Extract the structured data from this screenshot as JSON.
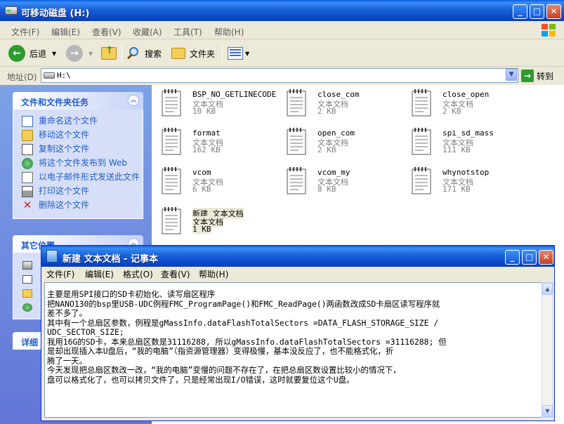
{
  "explorer": {
    "title": "可移动磁盘 (H:)",
    "menu": [
      "文件(F)",
      "编辑(E)",
      "查看(V)",
      "收藏(A)",
      "工具(T)",
      "帮助(H)"
    ],
    "toolbar": {
      "back_label": "后退",
      "search_label": "搜索",
      "folders_label": "文件夹"
    },
    "address": {
      "label": "地址(D)",
      "value": "H:\\",
      "go_label": "转到"
    },
    "task_pane": {
      "file_tasks": {
        "title": "文件和文件夹任务",
        "items": [
          {
            "label": "重命名这个文件",
            "icon": "rename-icon"
          },
          {
            "label": "移动这个文件",
            "icon": "move-icon"
          },
          {
            "label": "复制这个文件",
            "icon": "copy-icon"
          },
          {
            "label": "将这个文件发布到 Web",
            "icon": "web-publish-icon"
          },
          {
            "label": "以电子邮件形式发送此文件",
            "icon": "email-icon"
          },
          {
            "label": "打印这个文件",
            "icon": "print-icon"
          },
          {
            "label": "删除这个文件",
            "icon": "delete-icon"
          }
        ]
      },
      "other_places": {
        "title": "其它位置"
      },
      "details": {
        "title": "详细"
      }
    },
    "files": [
      {
        "name": "BSP_NO_GETLINECODE",
        "type": "文本文档",
        "size": "10 KB"
      },
      {
        "name": "close_com",
        "type": "文本文档",
        "size": "2 KB"
      },
      {
        "name": "close_open",
        "type": "文本文档",
        "size": "2 KB"
      },
      {
        "name": "format",
        "type": "文本文档",
        "size": "162 KB"
      },
      {
        "name": "open_com",
        "type": "文本文档",
        "size": "2 KB"
      },
      {
        "name": "spi_sd_mass",
        "type": "文本文档",
        "size": "111 KB"
      },
      {
        "name": "vcom",
        "type": "文本文档",
        "size": "6 KB"
      },
      {
        "name": "vcom_my",
        "type": "文本文档",
        "size": "8 KB"
      },
      {
        "name": "whynotstop",
        "type": "文本文档",
        "size": "171 KB"
      },
      {
        "name": "新建 文本文档",
        "type": "文本文档",
        "size": "1 KB",
        "selected": true
      }
    ]
  },
  "notepad": {
    "title": "新建 文本文档 - 记事本",
    "menu": [
      "文件(F)",
      "编辑(E)",
      "格式(O)",
      "查看(V)",
      "帮助(H)"
    ],
    "content": "主要是用SPI接口的SD卡初始化、读写扇区程序\n把NANO130的bsp里USB-UDC例程FMC_ProgramPage()和FMC_ReadPage()两函数改成SD卡扇区读写程序就\n差不多了。\n其中有一个总扇区参数，例程是gMassInfo.dataFlashTotalSectors =DATA_FLASH_STORAGE_SIZE /\nUDC_SECTOR_SIZE;\n我用16G的SD卡，本来总扇区数是31116288, 所以gMassInfo.dataFlashTotalSectors =31116288; 但\n是却出现插入本U盘后，“我的电脑”（指资源管理器）变得极慢，基本没反应了，也不能格式化，折\n腾了一天。\n今天发现把总扇区数改一改，“我的电脑”变慢的问题不存在了，在把总扇区数设置比较小的情况下，\n盘可以格式化了，也可以拷贝文件了，只是经常出现I/O错误，这时就要复位这个U盘。"
  }
}
